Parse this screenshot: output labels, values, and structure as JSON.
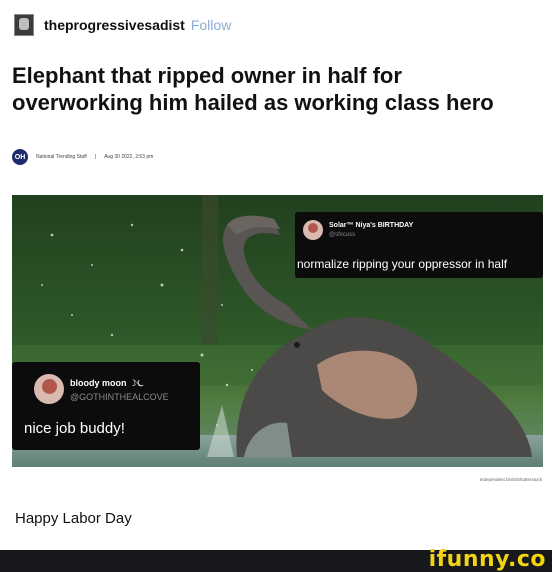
{
  "post": {
    "username": "theprogressivesadist",
    "follow_label": "Follow",
    "caption": "Happy Labor Day"
  },
  "article": {
    "headline": "Elephant that ripped owner in half for overworking him hailed as working class hero",
    "source_logo": "OH",
    "author": "National Trending Staff",
    "separator": "|",
    "date": "Aug 30 2022, 2:53 pm",
    "photo_credit": "Independent birds/Shutterstock"
  },
  "tweets": {
    "right": {
      "name": "Solar™ Niya's BIRTHDAY",
      "handle": "@sfxcuss",
      "text": "normalize ripping your oppressor in half"
    },
    "left": {
      "name": "bloody moon ☽⏾",
      "handle": "@GOTHINTHEALCOVE",
      "text": "nice job buddy!"
    }
  },
  "watermark": "ifunny.co",
  "colors": {
    "follow": "#8aaed6",
    "watermark": "#f2d415",
    "footer_bg": "#17181c"
  }
}
